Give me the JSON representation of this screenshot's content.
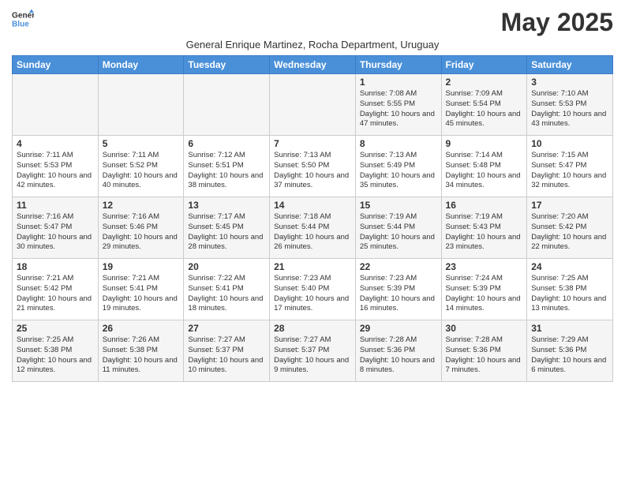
{
  "logo": {
    "line1": "General",
    "line2": "Blue"
  },
  "title": "May 2025",
  "subtitle": "General Enrique Martinez, Rocha Department, Uruguay",
  "days_of_week": [
    "Sunday",
    "Monday",
    "Tuesday",
    "Wednesday",
    "Thursday",
    "Friday",
    "Saturday"
  ],
  "weeks": [
    [
      {
        "day": "",
        "info": ""
      },
      {
        "day": "",
        "info": ""
      },
      {
        "day": "",
        "info": ""
      },
      {
        "day": "",
        "info": ""
      },
      {
        "day": "1",
        "info": "Sunrise: 7:08 AM\nSunset: 5:55 PM\nDaylight: 10 hours\nand 47 minutes."
      },
      {
        "day": "2",
        "info": "Sunrise: 7:09 AM\nSunset: 5:54 PM\nDaylight: 10 hours\nand 45 minutes."
      },
      {
        "day": "3",
        "info": "Sunrise: 7:10 AM\nSunset: 5:53 PM\nDaylight: 10 hours\nand 43 minutes."
      }
    ],
    [
      {
        "day": "4",
        "info": "Sunrise: 7:11 AM\nSunset: 5:53 PM\nDaylight: 10 hours\nand 42 minutes."
      },
      {
        "day": "5",
        "info": "Sunrise: 7:11 AM\nSunset: 5:52 PM\nDaylight: 10 hours\nand 40 minutes."
      },
      {
        "day": "6",
        "info": "Sunrise: 7:12 AM\nSunset: 5:51 PM\nDaylight: 10 hours\nand 38 minutes."
      },
      {
        "day": "7",
        "info": "Sunrise: 7:13 AM\nSunset: 5:50 PM\nDaylight: 10 hours\nand 37 minutes."
      },
      {
        "day": "8",
        "info": "Sunrise: 7:13 AM\nSunset: 5:49 PM\nDaylight: 10 hours\nand 35 minutes."
      },
      {
        "day": "9",
        "info": "Sunrise: 7:14 AM\nSunset: 5:48 PM\nDaylight: 10 hours\nand 34 minutes."
      },
      {
        "day": "10",
        "info": "Sunrise: 7:15 AM\nSunset: 5:47 PM\nDaylight: 10 hours\nand 32 minutes."
      }
    ],
    [
      {
        "day": "11",
        "info": "Sunrise: 7:16 AM\nSunset: 5:47 PM\nDaylight: 10 hours\nand 30 minutes."
      },
      {
        "day": "12",
        "info": "Sunrise: 7:16 AM\nSunset: 5:46 PM\nDaylight: 10 hours\nand 29 minutes."
      },
      {
        "day": "13",
        "info": "Sunrise: 7:17 AM\nSunset: 5:45 PM\nDaylight: 10 hours\nand 28 minutes."
      },
      {
        "day": "14",
        "info": "Sunrise: 7:18 AM\nSunset: 5:44 PM\nDaylight: 10 hours\nand 26 minutes."
      },
      {
        "day": "15",
        "info": "Sunrise: 7:19 AM\nSunset: 5:44 PM\nDaylight: 10 hours\nand 25 minutes."
      },
      {
        "day": "16",
        "info": "Sunrise: 7:19 AM\nSunset: 5:43 PM\nDaylight: 10 hours\nand 23 minutes."
      },
      {
        "day": "17",
        "info": "Sunrise: 7:20 AM\nSunset: 5:42 PM\nDaylight: 10 hours\nand 22 minutes."
      }
    ],
    [
      {
        "day": "18",
        "info": "Sunrise: 7:21 AM\nSunset: 5:42 PM\nDaylight: 10 hours\nand 21 minutes."
      },
      {
        "day": "19",
        "info": "Sunrise: 7:21 AM\nSunset: 5:41 PM\nDaylight: 10 hours\nand 19 minutes."
      },
      {
        "day": "20",
        "info": "Sunrise: 7:22 AM\nSunset: 5:41 PM\nDaylight: 10 hours\nand 18 minutes."
      },
      {
        "day": "21",
        "info": "Sunrise: 7:23 AM\nSunset: 5:40 PM\nDaylight: 10 hours\nand 17 minutes."
      },
      {
        "day": "22",
        "info": "Sunrise: 7:23 AM\nSunset: 5:39 PM\nDaylight: 10 hours\nand 16 minutes."
      },
      {
        "day": "23",
        "info": "Sunrise: 7:24 AM\nSunset: 5:39 PM\nDaylight: 10 hours\nand 14 minutes."
      },
      {
        "day": "24",
        "info": "Sunrise: 7:25 AM\nSunset: 5:38 PM\nDaylight: 10 hours\nand 13 minutes."
      }
    ],
    [
      {
        "day": "25",
        "info": "Sunrise: 7:25 AM\nSunset: 5:38 PM\nDaylight: 10 hours\nand 12 minutes."
      },
      {
        "day": "26",
        "info": "Sunrise: 7:26 AM\nSunset: 5:38 PM\nDaylight: 10 hours\nand 11 minutes."
      },
      {
        "day": "27",
        "info": "Sunrise: 7:27 AM\nSunset: 5:37 PM\nDaylight: 10 hours\nand 10 minutes."
      },
      {
        "day": "28",
        "info": "Sunrise: 7:27 AM\nSunset: 5:37 PM\nDaylight: 10 hours\nand 9 minutes."
      },
      {
        "day": "29",
        "info": "Sunrise: 7:28 AM\nSunset: 5:36 PM\nDaylight: 10 hours\nand 8 minutes."
      },
      {
        "day": "30",
        "info": "Sunrise: 7:28 AM\nSunset: 5:36 PM\nDaylight: 10 hours\nand 7 minutes."
      },
      {
        "day": "31",
        "info": "Sunrise: 7:29 AM\nSunset: 5:36 PM\nDaylight: 10 hours\nand 6 minutes."
      }
    ]
  ]
}
